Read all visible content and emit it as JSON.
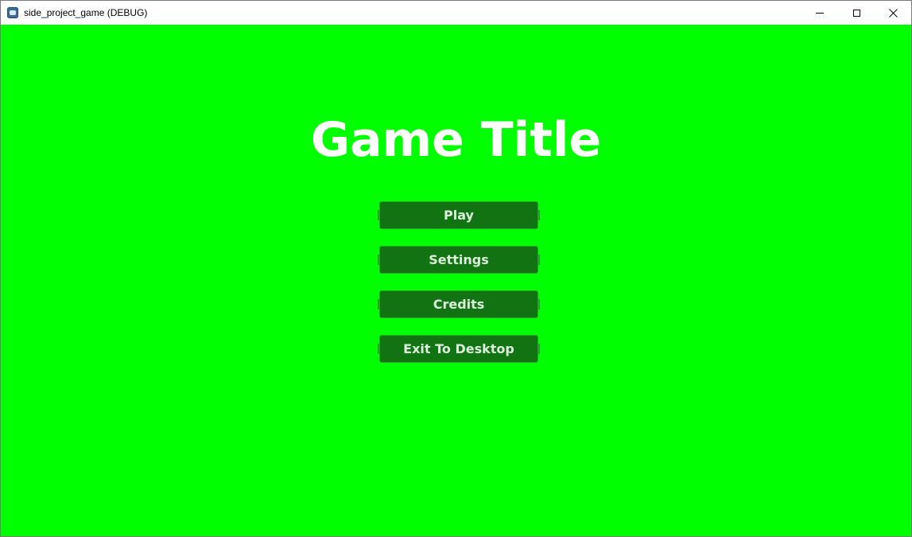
{
  "window": {
    "title": "side_project_game (DEBUG)",
    "icon": "godot-app-icon",
    "controls": {
      "minimize_icon": "minimize-icon",
      "maximize_icon": "maximize-icon",
      "close_icon": "close-icon",
      "close_glyph": "✕"
    }
  },
  "game": {
    "background_color": "#00ff00",
    "title": "Game Title",
    "menu": {
      "play_label": "Play",
      "settings_label": "Settings",
      "credits_label": "Credits",
      "exit_label": "Exit To Desktop"
    }
  },
  "colors": {
    "button_bg": "#127312",
    "button_border": "#2fa02f",
    "button_text": "#dcefdc",
    "title_text": "#ffffff"
  }
}
